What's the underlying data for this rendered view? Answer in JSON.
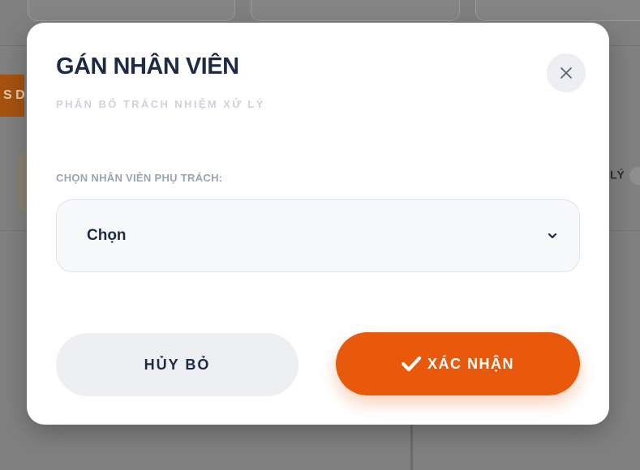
{
  "modal": {
    "title": "GÁN NHÂN VIÊN",
    "subtitle": "PHÂN BỔ TRÁCH NHIỆM XỬ LÝ",
    "close_icon": "close-icon"
  },
  "assign_form": {
    "label": "CHỌN NHÂN VIÊN PHỤ TRÁCH:",
    "select_value": "Chọn",
    "dropdown_icon": "chevron-down-icon"
  },
  "actions": {
    "cancel_label": "HỦY BỎ",
    "confirm_label": "XÁC NHẬN",
    "confirm_icon": "check-icon"
  },
  "background": {
    "side_label": "LÝ",
    "orange_tag": "S DA"
  },
  "colors": {
    "accent": "#e8590c",
    "title": "#1e2a44",
    "overlay": "#808080"
  }
}
